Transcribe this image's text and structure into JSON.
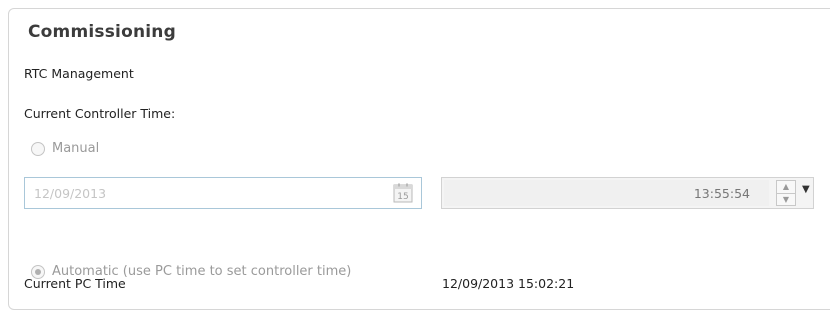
{
  "panel": {
    "title": "Commissioning",
    "section_label": "RTC Management",
    "controller_time_label": "Current Controller Time:"
  },
  "manual_option": {
    "label": "Manual",
    "selected": false
  },
  "date_field": {
    "value": "12/09/2013",
    "calendar_day": "15"
  },
  "time_field": {
    "value": "13:55:54"
  },
  "automatic_option": {
    "label": "Automatic (use PC time to set controller time)",
    "selected": true
  },
  "pc_time": {
    "label": "Current PC Time",
    "value": "12/09/2013 15:02:21"
  },
  "icons": [
    "calendar-icon",
    "spin-up-icon",
    "spin-down-icon",
    "dropdown-arrow-icon"
  ],
  "colors": {
    "focus_border": "#a9c7d9",
    "disabled_text": "#9a9a9a"
  }
}
